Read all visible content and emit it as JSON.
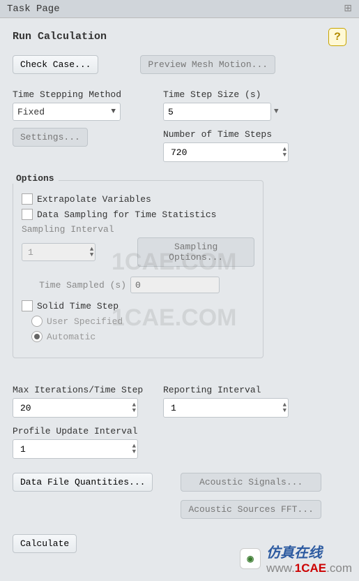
{
  "window": {
    "title": "Task Page"
  },
  "header": {
    "title": "Run Calculation",
    "help_label": "?"
  },
  "top_buttons": {
    "check_case": "Check Case...",
    "preview_mesh_motion": "Preview Mesh Motion..."
  },
  "time_stepping": {
    "method_label": "Time Stepping Method",
    "method_value": "Fixed",
    "settings_btn": "Settings...",
    "step_size_label": "Time Step Size (s)",
    "step_size_value": "5",
    "num_steps_label": "Number of Time Steps",
    "num_steps_value": "720"
  },
  "options": {
    "title": "Options",
    "extrapolate": "Extrapolate Variables",
    "data_sampling": "Data Sampling for Time Statistics",
    "sampling_interval_label": "Sampling Interval",
    "sampling_interval_value": "1",
    "sampling_options_btn": "Sampling Options...",
    "time_sampled_label": "Time Sampled (s)",
    "time_sampled_value": "0",
    "solid_time_step": "Solid Time Step",
    "user_specified": "User Specified",
    "automatic": "Automatic"
  },
  "iterations": {
    "max_iter_label": "Max Iterations/Time Step",
    "max_iter_value": "20",
    "reporting_label": "Reporting Interval",
    "reporting_value": "1",
    "profile_label": "Profile Update Interval",
    "profile_value": "1"
  },
  "bottom_buttons": {
    "data_file_q": "Data File Quantities...",
    "acoustic_signals": "Acoustic Signals...",
    "acoustic_fft": "Acoustic Sources FFT...",
    "calculate": "Calculate"
  },
  "watermark": {
    "ghost1": "1CAE.COM",
    "ghost2": "1CAE.COM",
    "brand_cn": "仿真在线",
    "url_pre": "www.",
    "url_main": "1CAE",
    "url_post": ".com"
  }
}
